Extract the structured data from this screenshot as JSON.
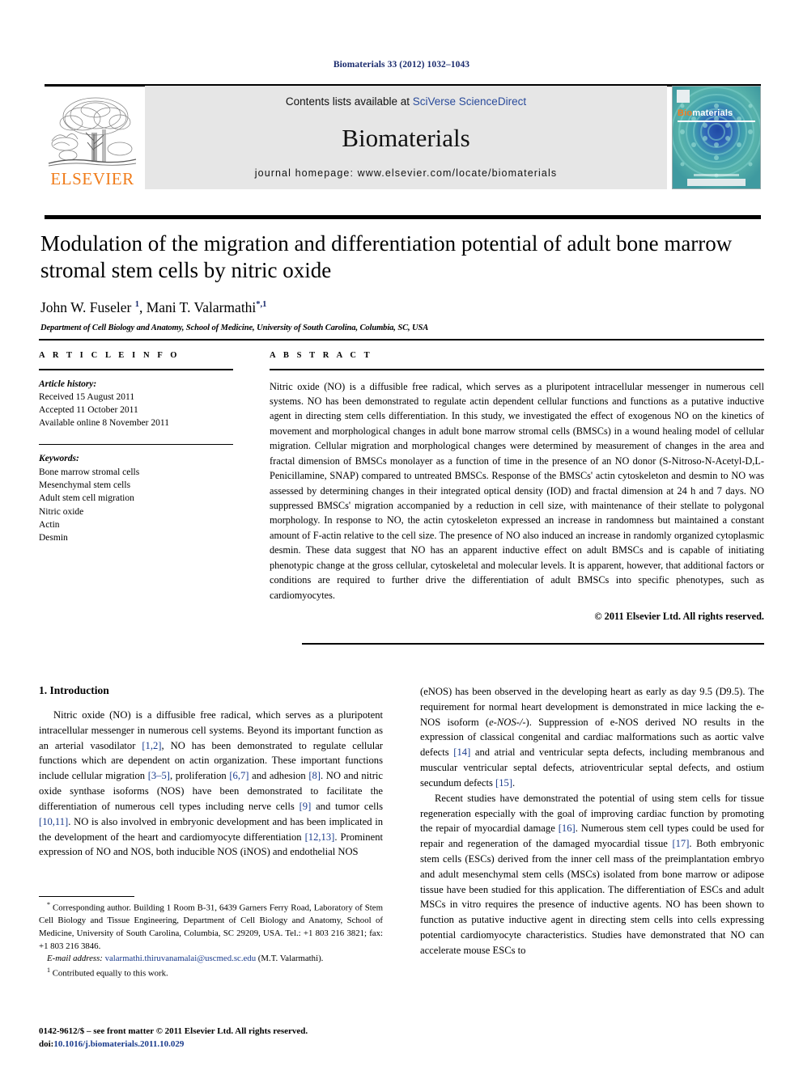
{
  "running_head": "Biomaterials 33 (2012) 1032–1043",
  "masthead": {
    "publisher_logo_text": "ELSEVIER",
    "contents_prefix": "Contents lists available at ",
    "contents_link": "SciVerse ScienceDirect",
    "journal_name": "Biomaterials",
    "homepage_line": "journal homepage: www.elsevier.com/locate/biomaterials",
    "cover": {
      "brand_first": "Bio",
      "brand_rest": "materials"
    }
  },
  "article": {
    "title": "Modulation of the migration and differentiation potential of adult bone marrow stromal stem cells by nitric oxide",
    "authors_html": "John W. Fuseler <sup>1</sup>, Mani T. Valarmathi<sup>*,1</sup>",
    "affiliation": "Department of Cell Biology and Anatomy, School of Medicine, University of South Carolina, Columbia, SC, USA"
  },
  "article_info": {
    "heading": "A R T I C L E   I N F O",
    "history_label": "Article history:",
    "history": [
      "Received 15 August 2011",
      "Accepted 11 October 2011",
      "Available online 8 November 2011"
    ],
    "keywords_label": "Keywords:",
    "keywords": [
      "Bone marrow stromal cells",
      "Mesenchymal stem cells",
      "Adult stem cell migration",
      "Nitric oxide",
      "Actin",
      "Desmin"
    ]
  },
  "abstract": {
    "heading": "A B S T R A C T",
    "text": "Nitric oxide (NO) is a diffusible free radical, which serves as a pluripotent intracellular messenger in numerous cell systems. NO has been demonstrated to regulate actin dependent cellular functions and functions as a putative inductive agent in directing stem cells differentiation. In this study, we investigated the effect of exogenous NO on the kinetics of movement and morphological changes in adult bone marrow stromal cells (BMSCs) in a wound healing model of cellular migration. Cellular migration and morphological changes were determined by measurement of changes in the area and fractal dimension of BMSCs monolayer as a function of time in the presence of an NO donor (S-Nitroso-N-Acetyl-D,L-Penicillamine, SNAP) compared to untreated BMSCs. Response of the BMSCs' actin cytoskeleton and desmin to NO was assessed by determining changes in their integrated optical density (IOD) and fractal dimension at 24 h and 7 days. NO suppressed BMSCs' migration accompanied by a reduction in cell size, with maintenance of their stellate to polygonal morphology. In response to NO, the actin cytoskeleton expressed an increase in randomness but maintained a constant amount of F-actin relative to the cell size. The presence of NO also induced an increase in randomly organized cytoplasmic desmin. These data suggest that NO has an apparent inductive effect on adult BMSCs and is capable of initiating phenotypic change at the gross cellular, cytoskeletal and molecular levels. It is apparent, however, that additional factors or conditions are required to further drive the differentiation of adult BMSCs into specific phenotypes, such as cardiomyocytes.",
    "copyright": "© 2011 Elsevier Ltd. All rights reserved."
  },
  "introduction": {
    "heading": "1. Introduction",
    "left_paragraph_html": "Nitric oxide (NO) is a diffusible free radical, which serves as a pluripotent intracellular messenger in numerous cell systems. Beyond its important function as an arterial vasodilator <span class=\"ref\">[1,2]</span>, NO has been demonstrated to regulate cellular functions which are dependent on actin organization. These important functions include cellular migration <span class=\"ref\">[3–5]</span>, proliferation <span class=\"ref\">[6,7]</span> and adhesion <span class=\"ref\">[8]</span>. NO and nitric oxide synthase isoforms (NOS) have been demonstrated to facilitate the differentiation of numerous cell types including nerve cells <span class=\"ref\">[9]</span> and tumor cells <span class=\"ref\">[10,11]</span>. NO is also involved in embryonic development and has been implicated in the development of the heart and cardiomyocyte differentiation <span class=\"ref\">[12,13]</span>. Prominent expression of NO and NOS, both inducible NOS (iNOS) and endothelial NOS",
    "right_paragraph_1_html": "(eNOS) has been observed in the developing heart as early as day 9.5 (D9.5). The requirement for normal heart development is demonstrated in mice lacking the e-NOS isoform (<span class=\"ital\">e-NOS-/-</span>). Suppression of e-NOS derived NO results in the expression of classical congenital and cardiac malformations such as aortic valve defects <span class=\"ref\">[14]</span> and atrial and ventricular septa defects, including membranous and muscular ventricular septal defects, atrioventricular septal defects, and ostium secundum defects <span class=\"ref\">[15]</span>.",
    "right_paragraph_2_html": "Recent studies have demonstrated the potential of using stem cells for tissue regeneration especially with the goal of improving cardiac function by promoting the repair of myocardial damage <span class=\"ref\">[16]</span>. Numerous stem cell types could be used for repair and regeneration of the damaged myocardial tissue <span class=\"ref\">[17]</span>. Both embryonic stem cells (ESCs) derived from the inner cell mass of the preimplantation embryo and adult mesenchymal stem cells (MSCs) isolated from bone marrow or adipose tissue have been studied for this application. The differentiation of ESCs and adult MSCs in vitro requires the presence of inductive agents. NO has been shown to function as putative inductive agent in directing stem cells into cells expressing potential cardiomyocyte characteristics. Studies have demonstrated that NO can accelerate mouse ESCs to"
  },
  "footnotes": {
    "corresponding_html": "<sup>*</sup> Corresponding author. Building 1 Room B-31, 6439 Garners Ferry Road, Laboratory of Stem Cell Biology and Tissue Engineering, Department of Cell Biology and Anatomy, School of Medicine, University of South Carolina, Columbia, SC 29209, USA. Tel.: +1 803 216 3821; fax: +1 803 216 3846.",
    "email_html": "<span class=\"fn-italic\">E-mail address:</span> <span class=\"email-link\">valarmathi.thiruvanamalai@uscmed.sc.edu</span> (M.T. Valarmathi).",
    "contributed_html": "<sup>1</sup> Contributed equally to this work."
  },
  "imprint": {
    "line1": "0142-9612/$ – see front matter © 2011 Elsevier Ltd. All rights reserved.",
    "doi_prefix": "doi:",
    "doi": "10.1016/j.biomaterials.2011.10.029"
  },
  "colors": {
    "link_blue": "#2a4b9b",
    "ref_blue": "#1a3b8c",
    "elsevier_orange": "#f07c1a",
    "cover_teal": "#2f8f93",
    "masthead_grey": "#e6e6e6"
  }
}
